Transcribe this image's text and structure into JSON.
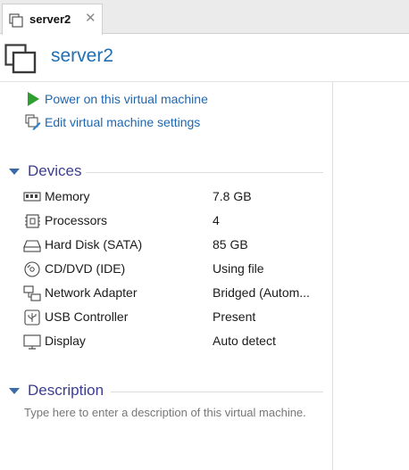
{
  "tab": {
    "title": "server2",
    "close_glyph": "✕",
    "icon": "vm-icon"
  },
  "header": {
    "title": "server2",
    "icon": "vm-large-icon"
  },
  "actions": [
    {
      "label": "Power on this virtual machine",
      "icon": "play-icon"
    },
    {
      "label": "Edit virtual machine settings",
      "icon": "edit-settings-icon"
    }
  ],
  "devices": {
    "title": "Devices",
    "items": [
      {
        "name": "Memory",
        "value": "7.8 GB",
        "icon": "memory-icon"
      },
      {
        "name": "Processors",
        "value": "4",
        "icon": "processor-icon"
      },
      {
        "name": "Hard Disk (SATA)",
        "value": "85 GB",
        "icon": "hard-disk-icon"
      },
      {
        "name": "CD/DVD (IDE)",
        "value": "Using file",
        "icon": "cd-dvd-icon"
      },
      {
        "name": "Network Adapter",
        "value": "Bridged (Autom...",
        "icon": "network-adapter-icon"
      },
      {
        "name": "USB Controller",
        "value": "Present",
        "icon": "usb-icon"
      },
      {
        "name": "Display",
        "value": "Auto detect",
        "icon": "display-icon"
      }
    ]
  },
  "description": {
    "title": "Description",
    "placeholder": "Type here to enter a description of this virtual machine."
  },
  "colors": {
    "accent": "#1f6fb2",
    "section_title": "#3d3e8f",
    "play_green": "#2e9e2e",
    "placeholder_gray": "#777777"
  }
}
